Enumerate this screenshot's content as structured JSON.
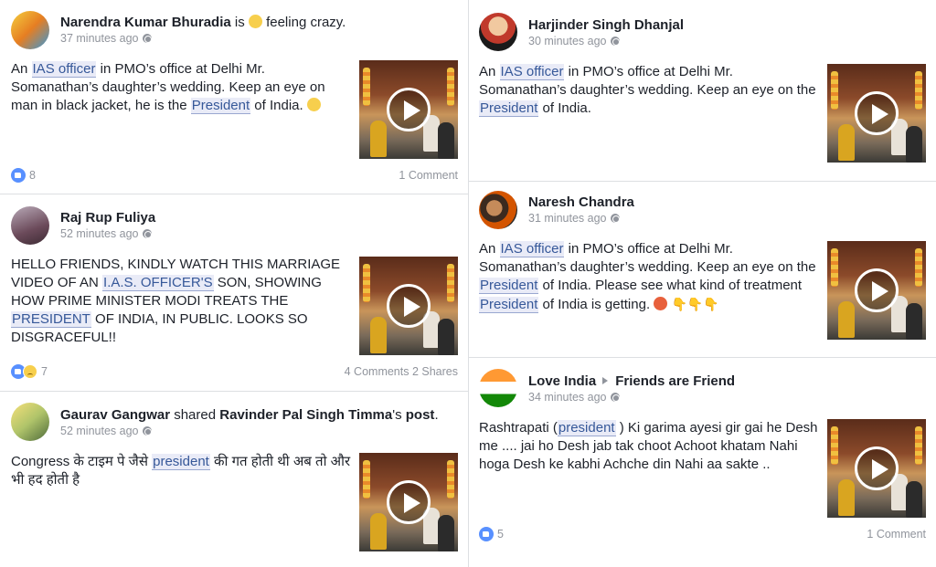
{
  "colors": {
    "link_highlight": "#e9ebf7",
    "link_text": "#365899",
    "meta_gray": "#90949c",
    "like_blue": "#5890ff"
  },
  "posts": [
    {
      "author": "Narendra Kumar Bhuradia",
      "activity_prefix": "is",
      "activity_emoji": "crazy-face-emoji",
      "activity_text": "feeling crazy.",
      "time": "37 minutes ago",
      "text": {
        "p1": "An ",
        "h1": "IAS officer",
        "p2": " in PMO’s office at Delhi Mr. Somanathan’s daughter’s wedding. Keep an eye on man in black jacket, he is the ",
        "h2": "President",
        "p3": " of India."
      },
      "reaction_count": "8",
      "comments": "1 Comment",
      "shares": ""
    },
    {
      "author": "Raj Rup Fuliya",
      "time": "52 minutes ago",
      "text": {
        "p1": "HELLO FRIENDS, KINDLY WATCH THIS MARRIAGE VIDEO OF AN ",
        "h1": "I.A.S. OFFICER'S",
        "p2": " SON, SHOWING HOW PRIME MINISTER MODI TREATS THE ",
        "h2": "PRESIDENT",
        "p3": " OF INDIA, IN PUBLIC. LOOKS SO DISGRACEFUL!!"
      },
      "reaction_count": "7",
      "comments": "4 Comments",
      "shares": "2 Shares"
    },
    {
      "author": "Gaurav Gangwar",
      "shared_word": "shared",
      "shared_from": "Ravinder Pal Singh Timma",
      "shared_suffix": "'s",
      "post_word": "post",
      "time": "52 minutes ago",
      "text": {
        "p1": "Congress के टाइम पे जैसे ",
        "h1": "president",
        "p2": " की गत होती थी अब तो और भी हद होती है"
      }
    },
    {
      "author": "Harjinder Singh Dhanjal",
      "time": "30 minutes ago",
      "text": {
        "p1": "An ",
        "h1": "IAS officer",
        "p2": " in PMO’s office at Delhi Mr. Somanathan’s daughter’s wedding. Keep an eye on the ",
        "h2": "President",
        "p3": " of India."
      }
    },
    {
      "author": "Naresh Chandra",
      "time": "31 minutes ago",
      "text": {
        "p1": "An ",
        "h1": "IAS officer",
        "p2": " in PMO’s office at Delhi Mr. Somanathan’s daughter’s wedding. Keep an eye on the ",
        "h2": "President",
        "p3": " of India. Please see what kind of treatment ",
        "h3": "President",
        "p4": " of India is getting."
      }
    },
    {
      "author": "Love India",
      "target": "Friends are Friend",
      "time": "34 minutes ago",
      "text": {
        "p1": "Rashtrapati (",
        "h1": "president",
        "p2": " ) Ki garima ayesi gir gai he Desh me .... jai ho Desh jab tak choot Achoot khatam Nahi hoga Desh ke kabhi Achche din Nahi aa sakte .."
      },
      "reaction_count": "5",
      "comments": "1 Comment"
    }
  ]
}
